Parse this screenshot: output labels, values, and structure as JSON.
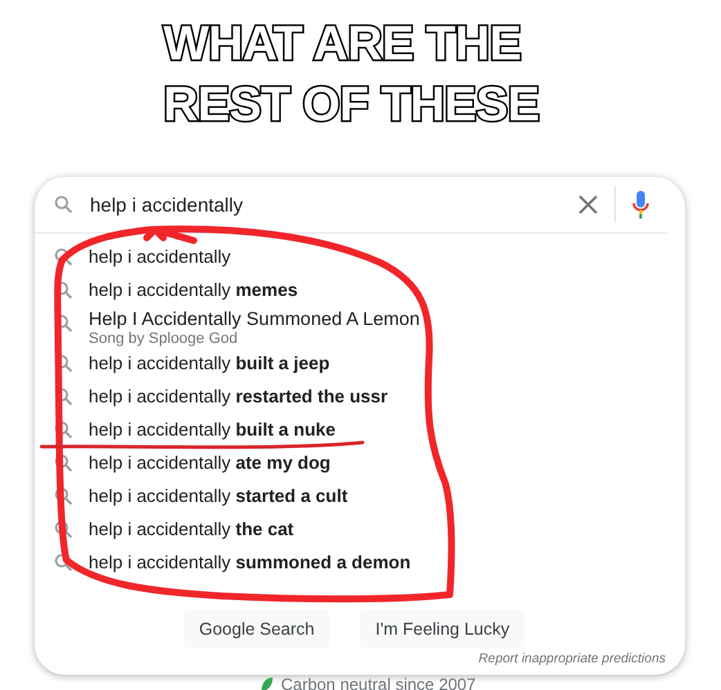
{
  "caption": [
    "WHAT ARE THE",
    "REST OF THESE"
  ],
  "search": {
    "value": "help i accidentally"
  },
  "suggestions": [
    {
      "kind": "query",
      "text": "help i accidentally"
    },
    {
      "kind": "query",
      "text": "help i accidentally **memes**"
    },
    {
      "kind": "entity",
      "text": "Help I Accidentally Summoned A Lemon",
      "subtitle": "Song by Splooge God"
    },
    {
      "kind": "query",
      "text": "help i accidentally **built a jeep**"
    },
    {
      "kind": "query",
      "text": "help i accidentally **restarted the ussr**"
    },
    {
      "kind": "query",
      "text": "help i accidentally **built a nuke**"
    },
    {
      "kind": "query",
      "text": "help i accidentally **ate my dog**"
    },
    {
      "kind": "query",
      "text": "help i accidentally **started a cult**"
    },
    {
      "kind": "query",
      "text": "help i accidentally **the cat**"
    },
    {
      "kind": "query",
      "text": "help i accidentally **summoned a demon**"
    }
  ],
  "buttons": [
    "Google Search",
    "I'm Feeling Lucky"
  ],
  "report_link": "Report inappropriate predictions",
  "footer": "Carbon neutral since 2007"
}
